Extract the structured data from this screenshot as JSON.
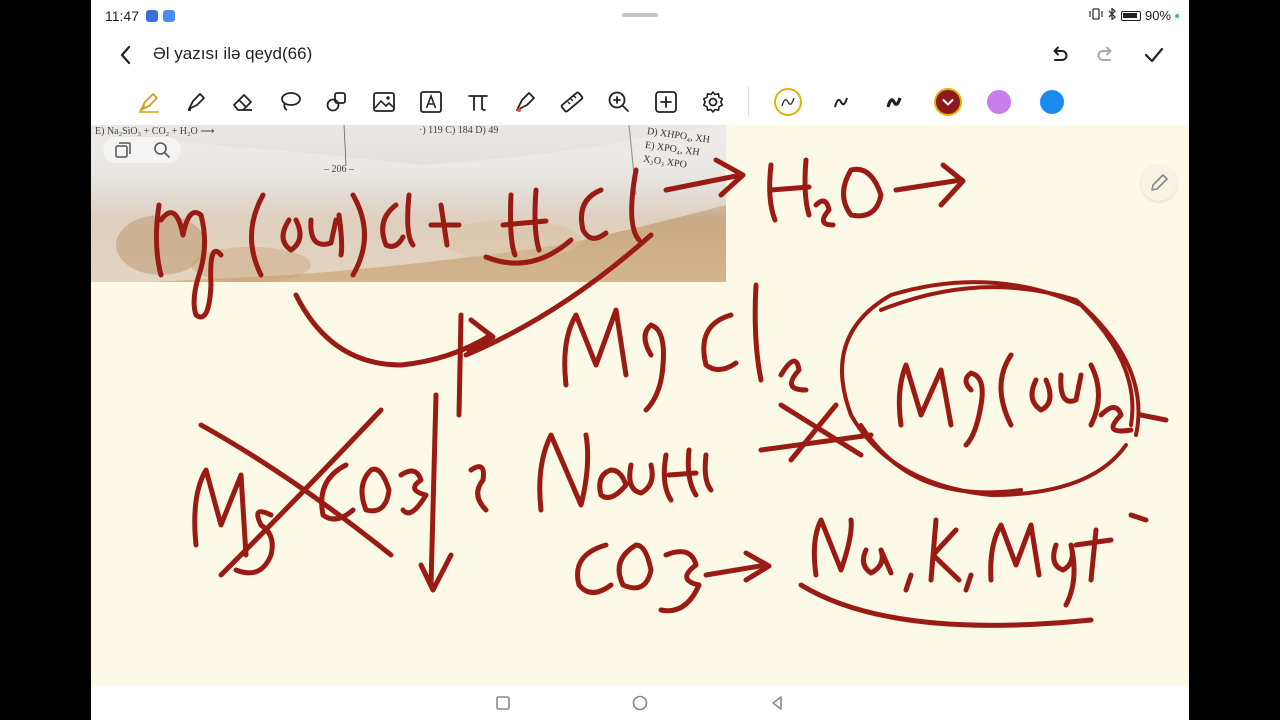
{
  "status_bar": {
    "time": "11:47",
    "battery": "90%",
    "icons": [
      "app-notification-icon",
      "mail-icon",
      "vibrate-icon",
      "bluetooth-icon",
      "battery-icon"
    ]
  },
  "title_bar": {
    "title": "Əl yazısı ilə qeyd(66)",
    "actions": [
      "undo-icon",
      "redo-icon",
      "check-icon"
    ]
  },
  "toolbar": {
    "tools": [
      "fountain-pen-icon",
      "highlighter-icon",
      "eraser-icon",
      "lasso-icon",
      "shape-icon",
      "image-icon",
      "text-box-icon",
      "formula-icon",
      "laser-pointer-icon",
      "ruler-icon",
      "zoom-icon",
      "add-icon",
      "settings-icon"
    ],
    "pens": [
      "pen-thin-icon",
      "pen-medium-icon",
      "pen-bold-icon"
    ],
    "colors": {
      "selected": "#8b1a1a",
      "purple": "#c77dea",
      "blue": "#1a8cf0",
      "ink": "#9a1a14"
    }
  },
  "canvas": {
    "photo_text_left": "E) Na₂SiO₃ + CO₂ + H₂O ⟶",
    "photo_text_mid": "·) 119     C) 184     D) 49",
    "photo_page_number": "– 206 –",
    "photo_text_right": "D) XHPO₄, XH\nE) XPO₄, XH\nX₂O₃ XPO"
  },
  "nav_bar": {
    "buttons": [
      "recents-icon",
      "home-icon",
      "back-nav-icon"
    ]
  }
}
